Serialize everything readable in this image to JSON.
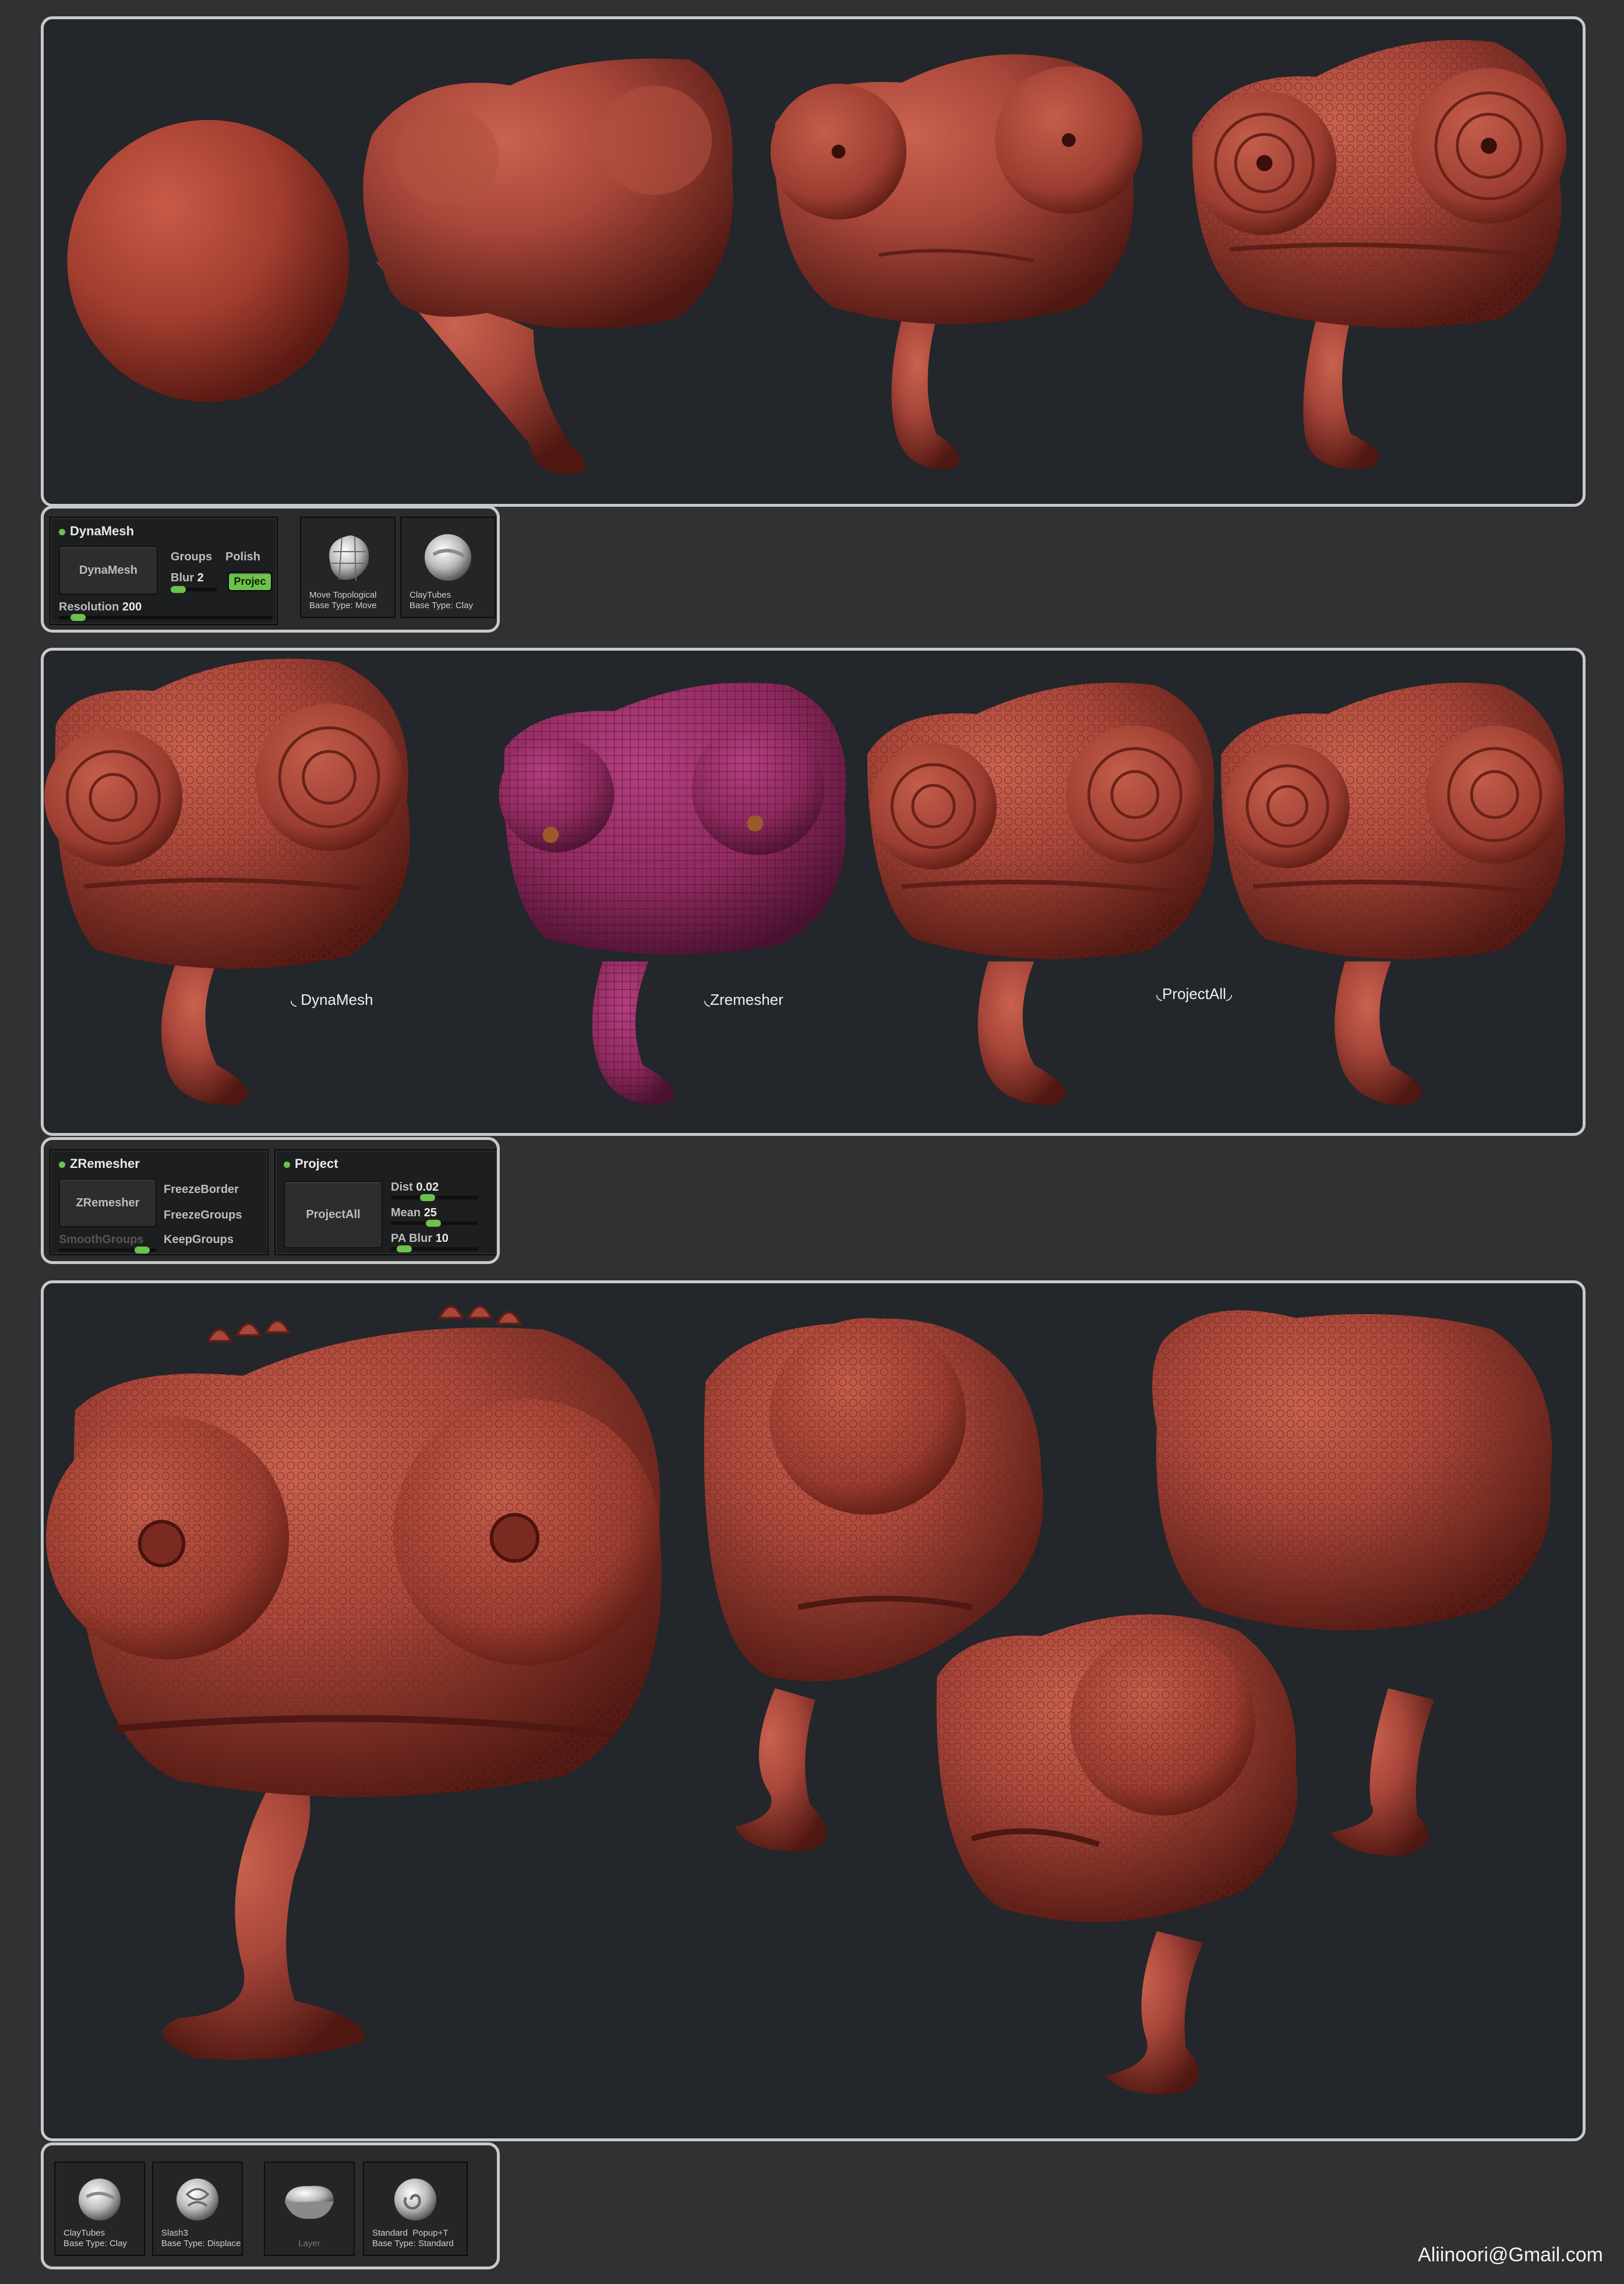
{
  "dynamesh_panel": {
    "title": "DynaMesh",
    "dynamesh_button": "DynaMesh",
    "groups_label": "Groups",
    "polish_label": "Polish",
    "blur_label": "Blur",
    "blur_value": "2",
    "project_button": "Projec",
    "resolution_label": "Resolution",
    "resolution_value": "200"
  },
  "brushes_row1": [
    {
      "name": "Move Topological",
      "base": "Base Type: Move",
      "icon": "move-topological-brush-icon"
    },
    {
      "name": "ClayTubes",
      "base": "Base Type: Clay",
      "icon": "claytubes-brush-icon"
    }
  ],
  "annotations": {
    "dynamesh": "DynaMesh",
    "zremesher": "Zremesher",
    "projectall": "ProjectAll"
  },
  "zremesher_panel": {
    "title": "ZRemesher",
    "zremesher_button": "ZRemesher",
    "freeze_border": "FreezeBorder",
    "freeze_groups": "FreezeGroups",
    "smooth_groups": "SmoothGroups",
    "keep_groups": "KeepGroups"
  },
  "project_panel": {
    "title": "Project",
    "projectall_button": "ProjectAll",
    "dist_label": "Dist",
    "dist_value": "0.02",
    "mean_label": "Mean",
    "mean_value": "25",
    "pablur_label": "PA Blur",
    "pablur_value": "10"
  },
  "brushes_row2": [
    {
      "name": "ClayTubes",
      "base": "Base Type: Clay",
      "icon": "claytubes-brush-icon"
    },
    {
      "name": "Slash3",
      "base": "Base Type: Displace",
      "icon": "slash3-brush-icon"
    },
    {
      "name": "Layer",
      "base": "",
      "icon": "layer-brush-icon"
    },
    {
      "name": "Standard",
      "extra": "Popup+T",
      "base": "Base Type: Standard",
      "icon": "standard-brush-icon"
    }
  ],
  "colors": {
    "clay": "#a8463a",
    "clay_dark": "#5e1f18",
    "wire": "#8f2a5e",
    "accent_green": "#6cc24a",
    "frame_border": "#c9c9c9",
    "viewport_bg": "#23262a"
  },
  "footer": {
    "email": "Aliinoori@Gmail.com"
  }
}
